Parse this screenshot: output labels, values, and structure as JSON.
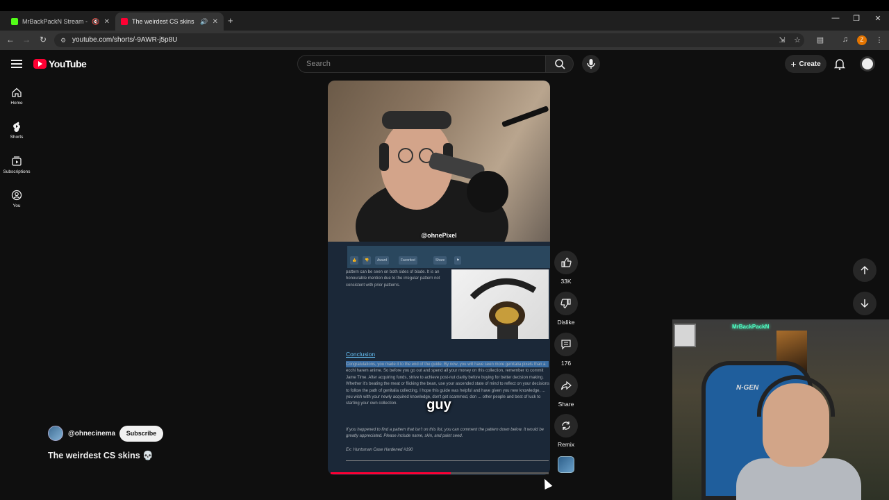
{
  "browser": {
    "tabs": [
      {
        "title": "MrBackPackN Stream - Wa",
        "favicon_color": "#53fc18",
        "active": false
      },
      {
        "title": "The weirdest CS skins 💀 -",
        "favicon_color": "#ff0033",
        "active": true
      }
    ],
    "new_tab": "+",
    "url": "youtube.com/shorts/-9AWR-j5p8U",
    "profile_initial": "Z"
  },
  "youtube": {
    "logo_text": "YouTube",
    "search_placeholder": "Search",
    "create_label": "Create"
  },
  "sidebar": {
    "items": [
      {
        "label": "Home",
        "icon": "home-icon"
      },
      {
        "label": "Shorts",
        "icon": "shorts-icon"
      },
      {
        "label": "Subscriptions",
        "icon": "subscriptions-icon"
      },
      {
        "label": "You",
        "icon": "you-icon"
      }
    ]
  },
  "short": {
    "overlay_handle": "@ohnePixel",
    "caption": "guy",
    "progress_fraction": 0.55,
    "steam": {
      "buttons": [
        "Award",
        "Favorited",
        "Share"
      ],
      "intro_text": "pattern can be seen on both sides of blade. It is an honourable mention due to the irregular pattern not consistent with prior patterns.",
      "conclusion_heading": "Conclusion",
      "conclusion_text": "Congratulations, you made it to the end of the guide. By now, you will have seen more genitalia pixels than a ecchi harem anime. So before you go out and spend all your money on this collection, remember to commit Jame Time. After acquiring funds, strive to achieve post-nut clarity before buying for better decision making. Whether it's beating the meat or flicking the bean, use your ascended state of mind to reflect on your decisions to follow the path of genitalia collecting. I hope this guide was helpful and have given you new knowledge, ... you wish with your newly acquired knowledge, don't get scammed, don ... other people and best of luck to starting your own collection.",
      "footnote": "If you happened to find a pattern that isn't on this list, you can comment the pattern down below. It would be greatly appreciated. Please include name, skin, and paint seed.",
      "example": "Ex: Huntsman Case Hardened #190"
    }
  },
  "actions": {
    "like_count": "33K",
    "dislike_label": "Dislike",
    "comment_count": "176",
    "share_label": "Share",
    "remix_label": "Remix"
  },
  "channel": {
    "name": "@ohnecinema",
    "subscribe_label": "Subscribe",
    "video_title": "The weirdest CS skins 💀"
  },
  "streamer_overlay": {
    "chair_brand": "N-GEN",
    "neon_sign": "MrBackPackN"
  },
  "colors": {
    "yt_red": "#ff0033",
    "steam_bg": "#1b2838",
    "steam_link": "#66c0f4"
  }
}
